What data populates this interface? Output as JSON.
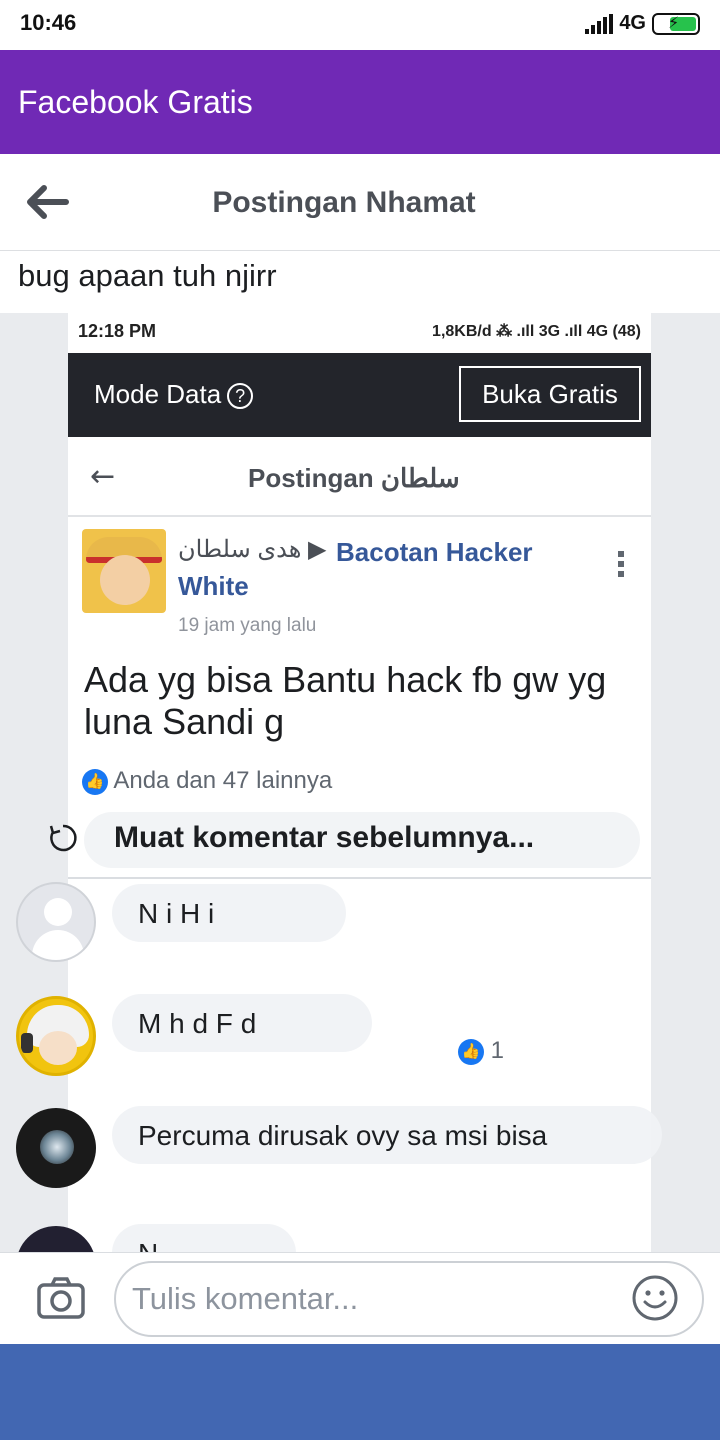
{
  "status_bar": {
    "time": "10:46",
    "network": "4G",
    "icons": [
      "signal-icon",
      "battery-charging-icon"
    ]
  },
  "app_bar": {
    "title": "Facebook Gratis",
    "color": "#7029b5"
  },
  "post_header": {
    "title": "Postingan Nhamat",
    "back_icon": "back-arrow-icon"
  },
  "post": {
    "text": "bug apaan tuh njirr"
  },
  "shared_image": {
    "status_time": "12:18 PM",
    "status_network": "1,8KB/d ⁂ .ıll 3G .ıll 4G (48)",
    "mode_label": "Mode Data",
    "help_glyph": "?",
    "button_label": "Buka Gratis",
    "header_title": "Postingan سلطان",
    "author": "هدى سلطان ▶",
    "group": "Bacotan Hacker White",
    "time_ago": "19 jam yang lalu",
    "body": "Ada yg bisa Bantu hack fb gw yg luna Sandi g",
    "reactions": "Anda dan 47 lainnya",
    "small_like_count": "1"
  },
  "load_more": {
    "label": "Muat komentar sebelumnya...",
    "icon": "reload-icon"
  },
  "comments": [
    {
      "avatar": "default-avatar",
      "text": "N  i   H   i"
    },
    {
      "avatar": "anime-avatar",
      "text": "M  h        d F   d"
    },
    {
      "avatar": "dark-avatar",
      "text": "Percuma dirusak ovy sa msi bisa"
    },
    {
      "avatar": "dark-avatar-2",
      "text": "N"
    }
  ],
  "composer": {
    "placeholder": "Tulis komentar...",
    "camera_icon": "camera-icon",
    "emoji_icon": "emoji-icon"
  },
  "bottom_nav": {
    "color": "#4267b2"
  }
}
